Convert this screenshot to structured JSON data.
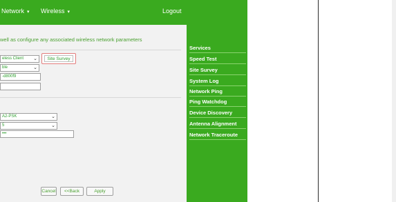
{
  "nav": {
    "network": "Network",
    "wireless": "Wireless",
    "logout": "Logout"
  },
  "form": {
    "intro": "well as configure any associated wireless network parameters",
    "mode_select": "eless Client",
    "site_survey_label": "Site Survey",
    "enable_select": "ble",
    "ssid_value": "-d800f9",
    "blank_field": "",
    "security_select": "A2-PSK",
    "cipher_select": "5",
    "key_value": "•••",
    "cancel_label": "Cancel",
    "back_label": "<<Back",
    "apply_label": "Apply"
  },
  "sidebar": {
    "items": [
      {
        "label": "Services"
      },
      {
        "label": "Speed Test"
      },
      {
        "label": "Site Survey"
      },
      {
        "label": "System Log"
      },
      {
        "label": "Network Ping"
      },
      {
        "label": "Ping Watchdog"
      },
      {
        "label": "Device Discovery"
      },
      {
        "label": "Antenna Alignment"
      },
      {
        "label": "Network Traceroute"
      }
    ]
  },
  "colors": {
    "accent_green": "#3aaa1f",
    "text_green": "#2e9e2e",
    "highlight_red": "#e27a7a"
  },
  "icons": [
    "chevron-down-icon",
    "caret-down-icon"
  ]
}
